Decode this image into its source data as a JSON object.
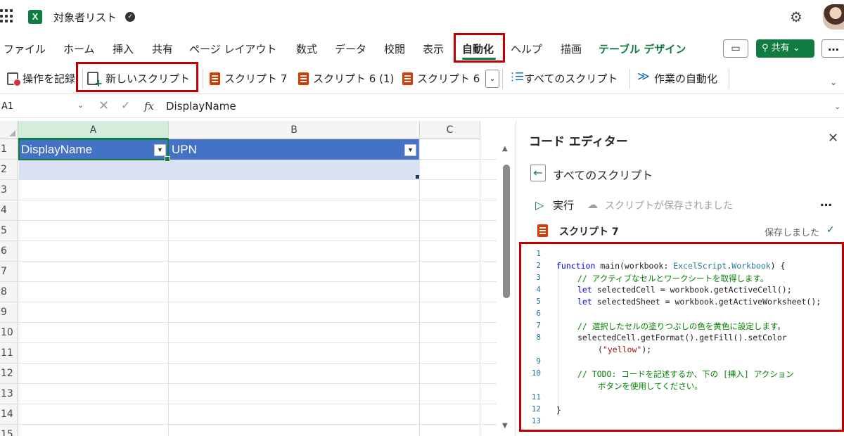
{
  "app": {
    "logo_letter": "X",
    "doc_title": "対象者リスト",
    "sync_icon": "cloud-sync-icon",
    "settings_icon": "gear-icon",
    "avatar": "user-avatar"
  },
  "ribbon": {
    "tabs": [
      "ファイル",
      "ホーム",
      "挿入",
      "共有",
      "ページ レイアウト",
      "数式",
      "データ",
      "校閲",
      "表示",
      "自動化",
      "ヘルプ",
      "描画",
      "テーブル デザイン"
    ],
    "active_tab": "自動化",
    "contextual_tab": "テーブル デザイン",
    "comment_icon": "comment-icon",
    "share_label": "共有",
    "more_label": "…",
    "commands": {
      "record": "操作を記録",
      "new_script": "新しいスクリプト",
      "script7": "スクリプト 7",
      "script6_1": "スクリプト 6 (1)",
      "script6": "スクリプト 6",
      "all_scripts": "すべてのスクリプト",
      "automate": "作業の自動化"
    }
  },
  "formula_bar": {
    "name_box": "A1",
    "fx_label": "fx",
    "value": "DisplayName"
  },
  "sheet": {
    "columns": [
      "A",
      "B",
      "C"
    ],
    "selected_column": "A",
    "rows": [
      "1",
      "2",
      "3",
      "4",
      "5",
      "6",
      "7",
      "8",
      "9",
      "10",
      "11",
      "12",
      "13",
      "14",
      "15"
    ],
    "table_headers": [
      "DisplayName",
      "UPN"
    ],
    "active_cell": "A1",
    "colors": {
      "table_header": "#4472c4",
      "table_row": "#d9e1f2",
      "accent": "#107c41"
    }
  },
  "editor_pane": {
    "title": "コード エディター",
    "back_label": "すべてのスクリプト",
    "run_label": "実行",
    "saved_status": "スクリプトが保存されました",
    "more_label": "…",
    "script_name": "スクリプト 7",
    "saved_right": "保存しました",
    "code_lines": [
      {
        "n": "1"
      },
      {
        "n": "2"
      },
      {
        "n": "3"
      },
      {
        "n": "4"
      },
      {
        "n": "5"
      },
      {
        "n": "6"
      },
      {
        "n": "7"
      },
      {
        "n": "8"
      },
      {
        "n": "9"
      },
      {
        "n": "10"
      },
      {
        "n": "11"
      },
      {
        "n": "12"
      },
      {
        "n": "13"
      }
    ],
    "code": {
      "l2_kw": "function",
      "l2_a": " main(workbook: ",
      "l2_type": "ExcelScript",
      "l2_dot": ".",
      "l2_type2": "Workbook",
      "l2_b": ") {",
      "l3": "// アクティブなセルとワークシートを取得します。",
      "l4_kw": "let",
      "l4": " selectedCell = workbook.getActiveCell();",
      "l5_kw": "let",
      "l5": " selectedSheet = workbook.getActiveWorksheet();",
      "l7": "// 選択したセルの塗りつぶしの色を黄色に設定します。",
      "l8": "selectedCell.getFormat().getFill().setColor",
      "l8b_open": "(",
      "l8b_str": "\"yellow\"",
      "l8b_close": ");",
      "l10": "// TODO: コードを記述するか、下の [挿入] アクション",
      "l10b": "ボタンを使用してください。",
      "l12": "}"
    }
  }
}
